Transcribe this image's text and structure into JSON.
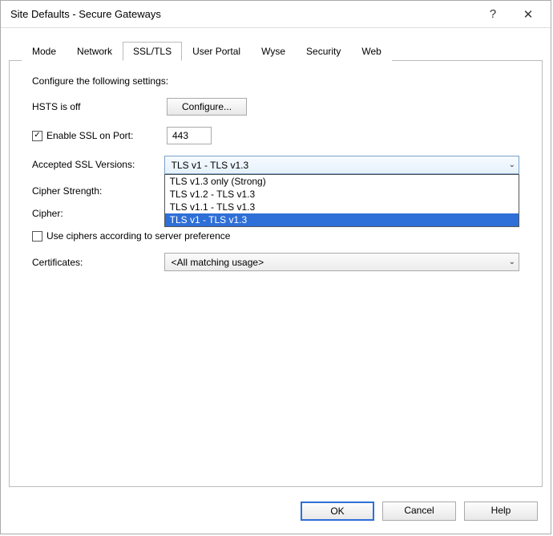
{
  "window": {
    "title": "Site Defaults - Secure Gateways"
  },
  "tabs": {
    "mode": "Mode",
    "network": "Network",
    "ssl": "SSL/TLS",
    "user_portal": "User Portal",
    "wyse": "Wyse",
    "security": "Security",
    "web": "Web"
  },
  "content": {
    "intro": "Configure the following settings:",
    "hsts_label": "HSTS is off",
    "configure_btn": "Configure...",
    "enable_ssl_label": "Enable SSL on Port:",
    "enable_ssl_port": "443",
    "accepted_versions_label": "Accepted SSL Versions:",
    "accepted_versions_value": "TLS v1 - TLS v1.3",
    "versions_options": {
      "opt1": "TLS v1.3 only (Strong)",
      "opt2": "TLS v1.2 - TLS v1.3",
      "opt3": "TLS v1.1 - TLS v1.3",
      "opt4": "TLS v1 - TLS v1.3"
    },
    "cipher_strength_label": "Cipher Strength:",
    "cipher_label": "Cipher:",
    "use_ciphers_pref_label": "Use ciphers according to server preference",
    "certificates_label": "Certificates:",
    "certificates_value": "<All matching usage>"
  },
  "footer": {
    "ok": "OK",
    "cancel": "Cancel",
    "help": "Help"
  }
}
